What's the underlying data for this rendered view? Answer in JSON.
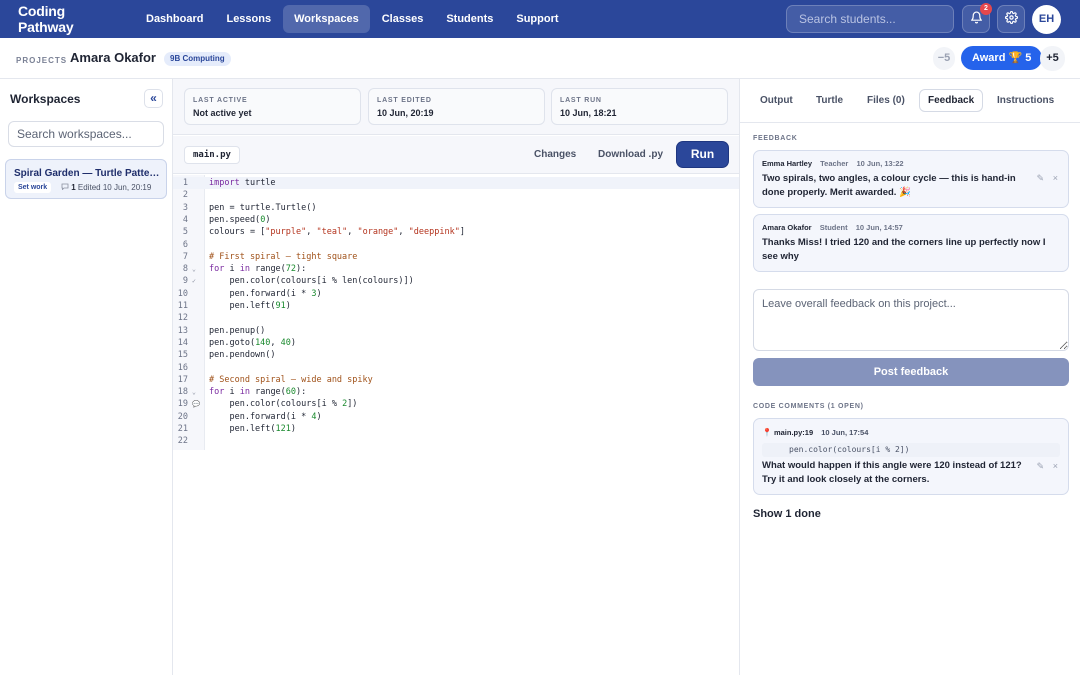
{
  "nav": {
    "brand": "Coding Pathway",
    "links": [
      "Dashboard",
      "Lessons",
      "Workspaces",
      "Classes",
      "Students",
      "Support"
    ],
    "active_link": "Workspaces",
    "search_placeholder": "Search students...",
    "notification_count": "2",
    "avatar_initials": "EH"
  },
  "project": {
    "label": "PROJECTS",
    "student_name": "Amara Okafor",
    "class_chip": "9B Computing",
    "minus_label": "−5",
    "award_label": "Award 🏆 5",
    "plus_label": "+5"
  },
  "sidebar": {
    "title": "Workspaces",
    "collapse_icon": "«",
    "search_placeholder": "Search workspaces...",
    "items": [
      {
        "title": "Spiral Garden — Turtle Patterns",
        "status": "Set work",
        "comment_count": "1",
        "edited": "Edited 10 Jun, 20:19"
      }
    ]
  },
  "stats": {
    "last_active_label": "LAST ACTIVE",
    "last_active_value": "Not active yet",
    "last_edited_label": "LAST EDITED",
    "last_edited_value": "10 Jun, 20:19",
    "last_run_label": "LAST RUN",
    "last_run_value": "10 Jun, 18:21"
  },
  "editor": {
    "file_tab": "main.py",
    "changes_label": "Changes",
    "download_label": "Download .py",
    "run_label": "Run",
    "lines": [
      {
        "n": "1",
        "t": "import turtle"
      },
      {
        "n": "2",
        "t": ""
      },
      {
        "n": "3",
        "t": "pen = turtle.Turtle()"
      },
      {
        "n": "4",
        "t": "pen.speed(0)"
      },
      {
        "n": "5",
        "t": "colours = [\"purple\", \"teal\", \"orange\", \"deeppink\"]"
      },
      {
        "n": "6",
        "t": ""
      },
      {
        "n": "7",
        "t": "# First spiral — tight square"
      },
      {
        "n": "8",
        "t": "for i in range(72):",
        "mark": "⌄"
      },
      {
        "n": "9",
        "t": "    pen.color(colours[i % len(colours)])",
        "mark": "✓"
      },
      {
        "n": "10",
        "t": "    pen.forward(i * 3)"
      },
      {
        "n": "11",
        "t": "    pen.left(91)"
      },
      {
        "n": "12",
        "t": ""
      },
      {
        "n": "13",
        "t": "pen.penup()"
      },
      {
        "n": "14",
        "t": "pen.goto(140, 40)"
      },
      {
        "n": "15",
        "t": "pen.pendown()"
      },
      {
        "n": "16",
        "t": ""
      },
      {
        "n": "17",
        "t": "# Second spiral — wide and spiky"
      },
      {
        "n": "18",
        "t": "for i in range(60):",
        "mark": "⌄"
      },
      {
        "n": "19",
        "t": "    pen.color(colours[i % 2])",
        "mark": "💬"
      },
      {
        "n": "20",
        "t": "    pen.forward(i * 4)"
      },
      {
        "n": "21",
        "t": "    pen.left(121)"
      },
      {
        "n": "22",
        "t": ""
      }
    ]
  },
  "panel": {
    "tabs": [
      "Output",
      "Turtle",
      "Files (0)",
      "Feedback",
      "Instructions"
    ],
    "active_tab": "Feedback",
    "feedback_label": "FEEDBACK",
    "feedback": [
      {
        "name": "Emma Hartley",
        "role": "Teacher",
        "time": "10 Jun, 13:22",
        "body": "Two spirals, two angles, a colour cycle — this is hand-in done properly. Merit awarded. 🎉"
      },
      {
        "name": "Amara Okafor",
        "role": "Student",
        "time": "10 Jun, 14:57",
        "body": "Thanks Miss! I tried 120 and the corners line up perfectly now I see why"
      }
    ],
    "feedback_placeholder": "Leave overall feedback on this project...",
    "post_label": "Post feedback",
    "code_comments_label": "CODE COMMENTS (1 OPEN)",
    "code_comment": {
      "location": "main.py:19",
      "time": "10 Jun, 17:54",
      "snippet": "pen.color(colours[i % 2])",
      "body": "What would happen if this angle were 120 instead of 121? Try it and look closely at the corners."
    },
    "show_done_label": "Show 1 done"
  },
  "colors": {
    "nav_bg": "#2b479a",
    "accent": "#2563eb",
    "keyword": "#7a2aa0",
    "string": "#b4341e",
    "number": "#1a8a2e",
    "comment": "#a0521a"
  }
}
